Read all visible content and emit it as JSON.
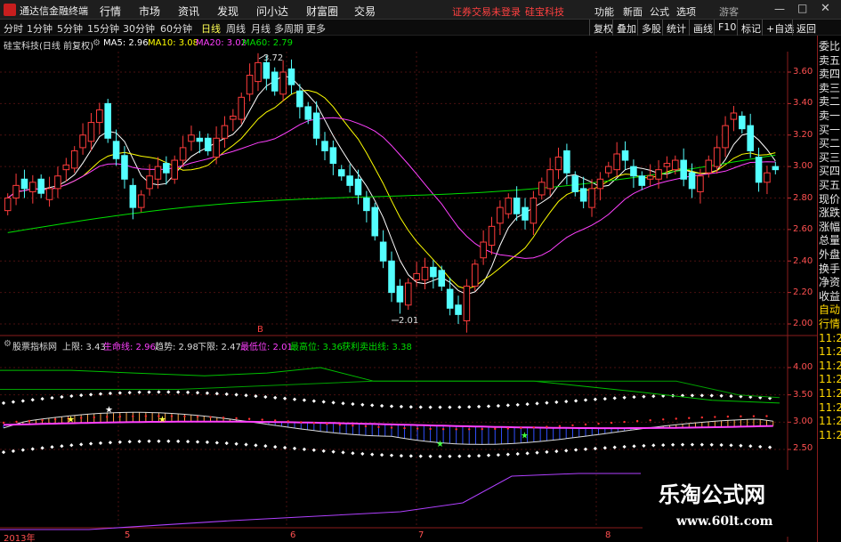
{
  "app": {
    "title": "通达信金融终端"
  },
  "menu": [
    "行情",
    "市场",
    "资讯",
    "发现",
    "问小达",
    "财富圈",
    "交易"
  ],
  "notice": "证券交易未登录",
  "stock_title": "硅宝科技",
  "toolbar_right": [
    "功能",
    "新面",
    "公式",
    "选项"
  ],
  "user": "游客",
  "periods": [
    "分时",
    "1分钟",
    "5分钟",
    "15分钟",
    "30分钟",
    "60分钟",
    "日线",
    "周线",
    "月线",
    "多周期",
    "更多"
  ],
  "active_period": "日线",
  "right_buttons": [
    "复权",
    "叠加",
    "多股",
    "统计",
    "画线",
    "F10",
    "标记",
    "+自选",
    "返回"
  ],
  "main_header": {
    "name": "硅宝科技(日线 前复权)",
    "ma5": "MA5: 2.96",
    "ma10": "MA10: 3.08",
    "ma20": "MA20: 3.02",
    "ma60": "MA60: 2.79"
  },
  "main_annotations": {
    "high": "3.72",
    "low": "2.01",
    "marker": "B"
  },
  "price_axis": [
    "3.60",
    "3.40",
    "3.20",
    "3.00",
    "2.80",
    "2.60",
    "2.40",
    "2.20",
    "2.00"
  ],
  "sub_header": {
    "name": "股票指标网",
    "upper": "上限: 3.43",
    "life": "生命线: 2.96",
    "trend": "趋势: 2.98",
    "lower": "下限: 2.47",
    "lowest": "最低位: 2.01",
    "highest": "最高位: 3.36",
    "sell": "获利卖出线: 3.38"
  },
  "sub_axis": [
    "4.00",
    "3.50",
    "3.00",
    "2.50"
  ],
  "x_axis": [
    "2013年",
    "5",
    "6",
    "7",
    "8"
  ],
  "sidebar": [
    "委比",
    "卖五",
    "卖四",
    "卖三",
    "卖二",
    "卖一",
    "买一",
    "买二",
    "买三",
    "买四",
    "买五",
    "现价",
    "涨跌",
    "涨幅",
    "总量",
    "外盘",
    "换手",
    "净资",
    "收益",
    "自动",
    "行情",
    "11:2",
    "11:2",
    "11:2",
    "11:2",
    "11:2",
    "11:2",
    "11:2",
    "11:2"
  ],
  "watermark": {
    "line1": "乐淘公式网",
    "line2": "www.60lt.com"
  },
  "colors": {
    "up": "#ff3c3c",
    "down": "#54ffff",
    "ma5": "#ffffff",
    "ma10": "#ffff00",
    "ma20": "#ff40ff",
    "ma60": "#00e000"
  },
  "chart_data": [
    {
      "type": "candlestick",
      "title": "硅宝科技(日线 前复权)",
      "ylim": [
        2.0,
        3.72
      ],
      "closes": [
        2.8,
        2.88,
        2.86,
        2.9,
        2.83,
        2.86,
        2.94,
        3.01,
        3.1,
        3.2,
        3.28,
        3.36,
        3.18,
        3.05,
        2.92,
        2.74,
        2.82,
        2.94,
        3.0,
        2.96,
        3.04,
        3.12,
        3.2,
        3.16,
        3.1,
        3.18,
        3.26,
        3.32,
        3.44,
        3.58,
        3.66,
        3.56,
        3.48,
        3.6,
        3.52,
        3.38,
        3.3,
        3.18,
        3.1,
        3.02,
        2.94,
        2.88,
        2.82,
        2.72,
        2.56,
        2.4,
        2.2,
        2.14,
        2.26,
        2.32,
        2.36,
        2.3,
        2.24,
        2.1,
        2.06,
        2.24,
        2.38,
        2.52,
        2.62,
        2.74,
        2.8,
        2.7,
        2.66,
        2.8,
        2.9,
        2.98,
        3.06,
        2.96,
        2.84,
        2.78,
        2.86,
        2.92,
        3.0,
        3.08,
        3.04,
        2.94,
        2.88,
        2.94,
        2.98,
        3.02,
        3.04,
        2.92,
        2.86,
        2.94,
        3.04,
        3.12,
        3.26,
        3.34,
        3.24,
        3.1,
        2.9,
        2.96,
        2.98
      ]
    },
    {
      "type": "line",
      "title": "股票指标网",
      "ylim": [
        2.3,
        4.1
      ],
      "series": [
        {
          "name": "上限",
          "value": 3.43
        },
        {
          "name": "生命线",
          "value": 2.96
        },
        {
          "name": "趋势",
          "value": 2.98
        },
        {
          "name": "下限",
          "value": 2.47
        },
        {
          "name": "最低位",
          "value": 2.01
        },
        {
          "name": "最高位",
          "value": 3.36
        },
        {
          "name": "获利卖出线",
          "value": 3.38
        }
      ]
    }
  ]
}
